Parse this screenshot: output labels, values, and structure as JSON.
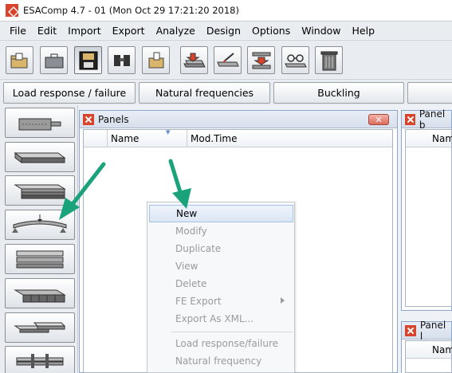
{
  "window": {
    "title": "ESAComp 4.7 - 01 (Mon Oct 29 17:21:20 2018)"
  },
  "menubar": {
    "items": [
      "File",
      "Edit",
      "Import",
      "Export",
      "Analyze",
      "Design",
      "Options",
      "Window",
      "Help"
    ]
  },
  "toolbar": {
    "buttons": [
      {
        "name": "open-folder-icon"
      },
      {
        "name": "briefcase-icon"
      },
      {
        "name": "save-icon",
        "pressed": true
      },
      {
        "name": "binoculars-icon"
      },
      {
        "name": "folder-document-icon"
      },
      {
        "name": "import-layer-icon"
      },
      {
        "name": "edit-layer-icon"
      },
      {
        "name": "transfer-layer-icon"
      },
      {
        "name": "glasses-icon"
      },
      {
        "name": "trash-icon"
      }
    ]
  },
  "tabs": {
    "items": [
      "Load response / failure",
      "Natural frequencies",
      "Buckling",
      ""
    ]
  },
  "left_buttons": {
    "items": [
      {
        "name": "ply-icon"
      },
      {
        "name": "laminate-icon"
      },
      {
        "name": "stacked-laminate-icon"
      },
      {
        "name": "beam-panel-icon"
      },
      {
        "name": "stiffened-beam-icon"
      },
      {
        "name": "grid-panel-icon"
      },
      {
        "name": "joint-icon"
      },
      {
        "name": "bolted-joint-icon"
      }
    ]
  },
  "panels_window": {
    "title": "Panels",
    "columns": [
      "",
      "Name",
      "Mod.Time"
    ]
  },
  "right_windows": {
    "top": {
      "title": "Panel b",
      "column": "Nam"
    },
    "bottom": {
      "title": "Panel l",
      "column": "Nam"
    }
  },
  "context_menu": {
    "items": [
      {
        "label": "New",
        "enabled": true
      },
      {
        "label": "Modify",
        "enabled": false
      },
      {
        "label": "Duplicate",
        "enabled": false
      },
      {
        "label": "View",
        "enabled": false
      },
      {
        "label": "Delete",
        "enabled": false
      },
      {
        "label": "FE Export",
        "enabled": false,
        "submenu": true
      },
      {
        "label": "Export As XML...",
        "enabled": false
      },
      {
        "label": "Load response/failure",
        "enabled": false
      },
      {
        "label": "Natural frequency",
        "enabled": false
      }
    ]
  },
  "colors": {
    "accent_arrow": "#1aa37a",
    "close_button": "#dd6b5c",
    "brand_red": "#d8442b"
  }
}
